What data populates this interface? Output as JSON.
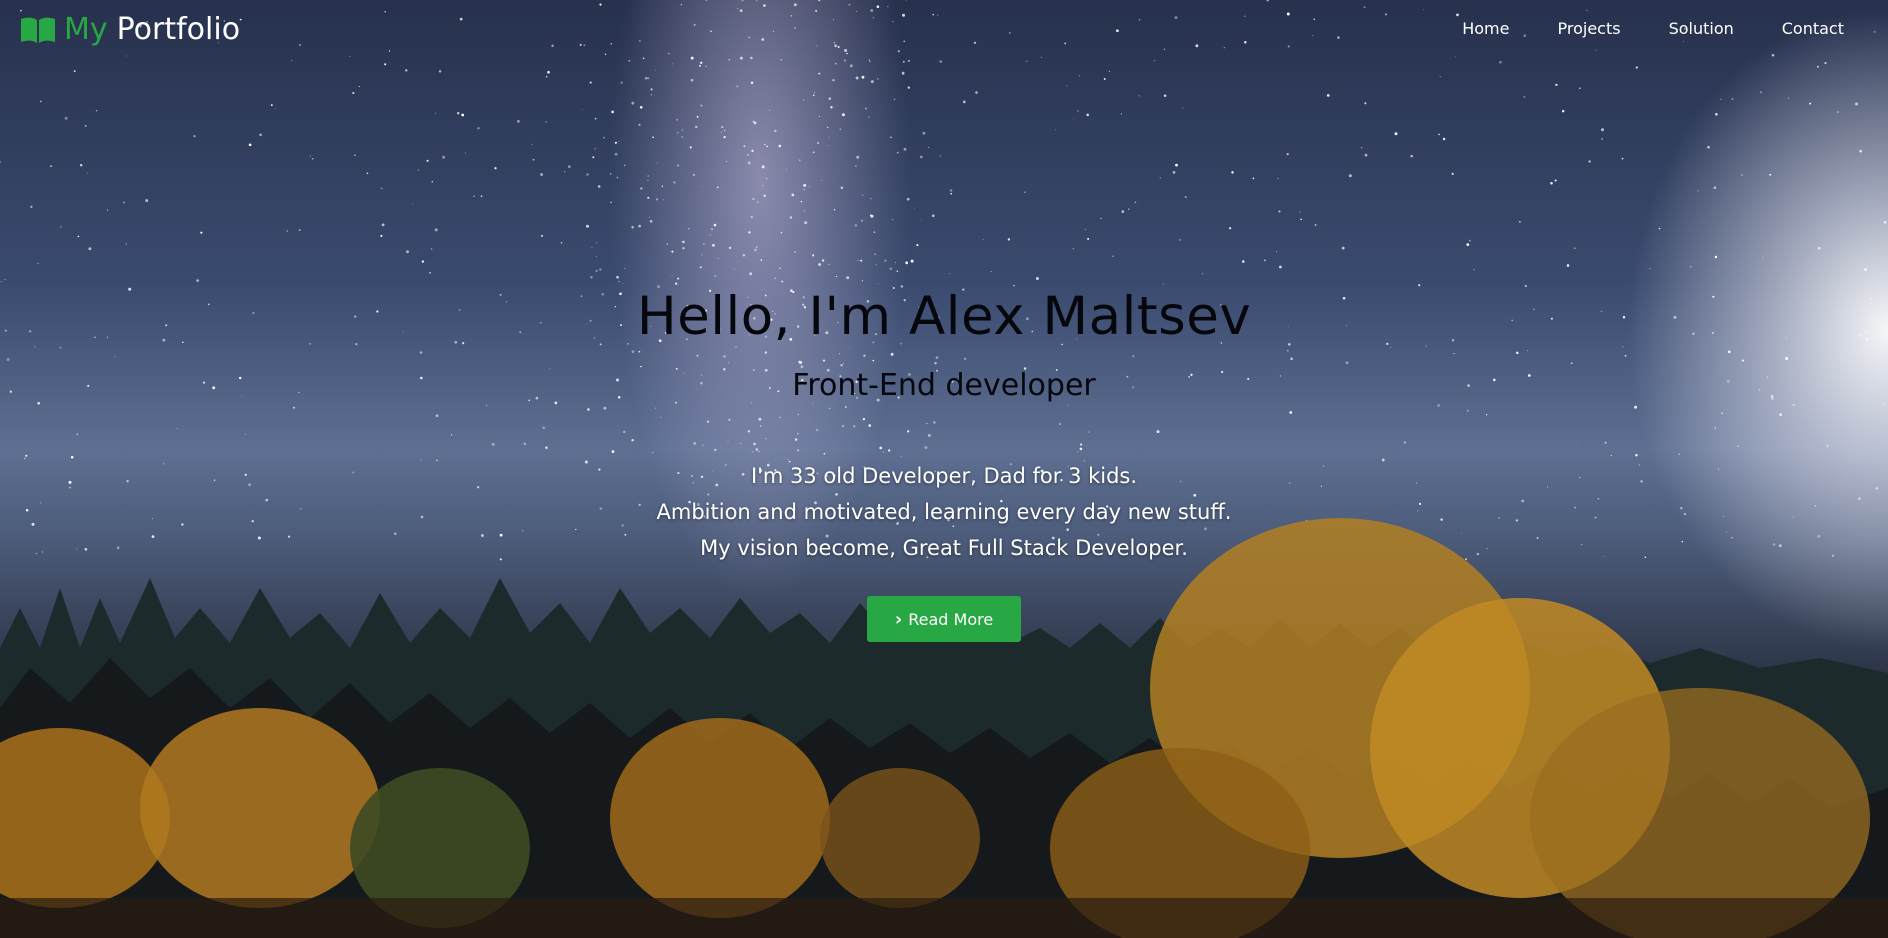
{
  "colors": {
    "accent": "#28a745",
    "nav_text": "#ffffff",
    "headline_text": "#05070c"
  },
  "brand": {
    "icon": "book-open-icon",
    "my": "My",
    "portfolio": "Portfolio"
  },
  "nav": {
    "items": [
      {
        "label": "Home"
      },
      {
        "label": "Projects"
      },
      {
        "label": "Solution"
      },
      {
        "label": "Contact"
      }
    ]
  },
  "hero": {
    "headline": "Hello, I'm Alex Maltsev",
    "subheadline": "Front-End developer",
    "bio": [
      "I'm 33 old Developer, Dad for 3 kids.",
      "Ambition and motivated, learning every day new stuff.",
      "My vision become, Great Full Stack Developer."
    ],
    "button": {
      "icon": "chevron-right-icon",
      "label": "Read More"
    }
  }
}
